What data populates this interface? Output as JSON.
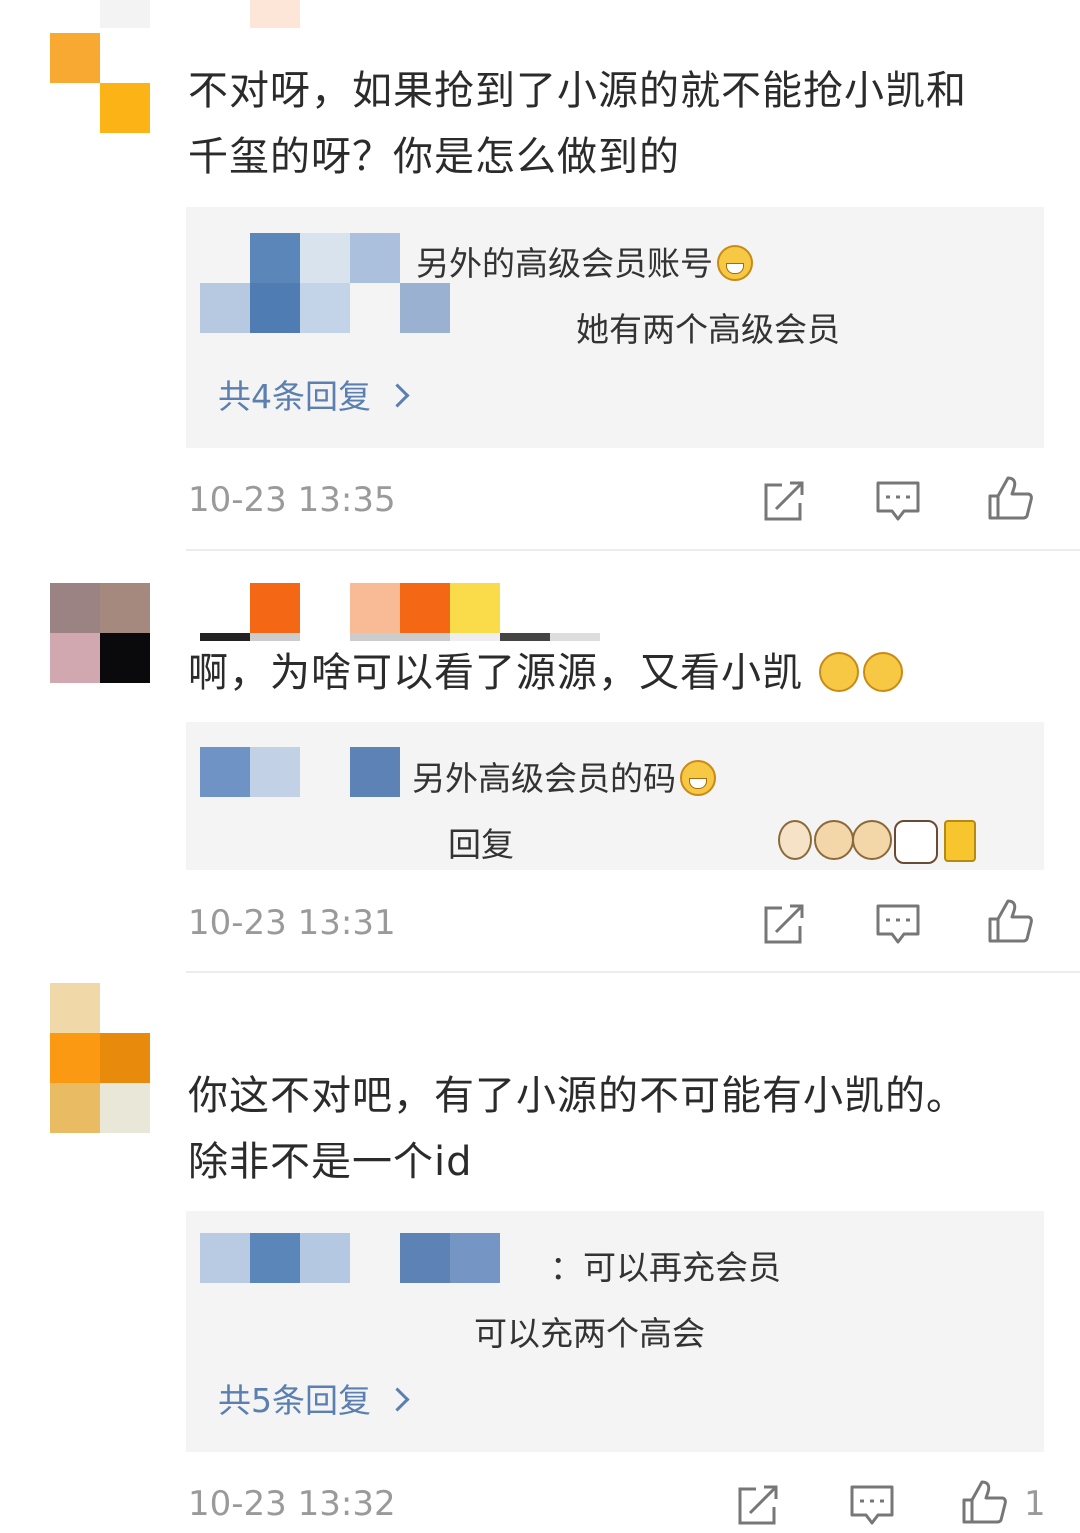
{
  "comments": [
    {
      "text_line1": "不对呀，如果抢到了小源的就不能抢小凯和",
      "text_line2": "千玺的呀？你是怎么做到的",
      "reply1": "另外的高级会员账号",
      "reply2": "她有两个高级会员",
      "more": "共4条回复",
      "time": "10-23 13:35"
    },
    {
      "text_line1": "啊，为啥可以看了源源，又看小凯",
      "reply1": "另外高级会员的码",
      "reply2": "回复",
      "time": "10-23 13:31"
    },
    {
      "text_line1": "你这不对吧，有了小源的不可能有小凯的。",
      "text_line2": "除非不是一个id",
      "reply1": "：可以再充会员",
      "reply2": "可以充两个高会",
      "more": "共5条回复",
      "time": "10-23 13:32",
      "likes": "1"
    }
  ],
  "icons": {
    "share": "share-icon",
    "comment": "comment-icon",
    "like": "like-icon"
  },
  "colors": {
    "link": "#5a7fb0",
    "time": "#9a9a9a",
    "reply_bg": "#f4f4f4"
  }
}
